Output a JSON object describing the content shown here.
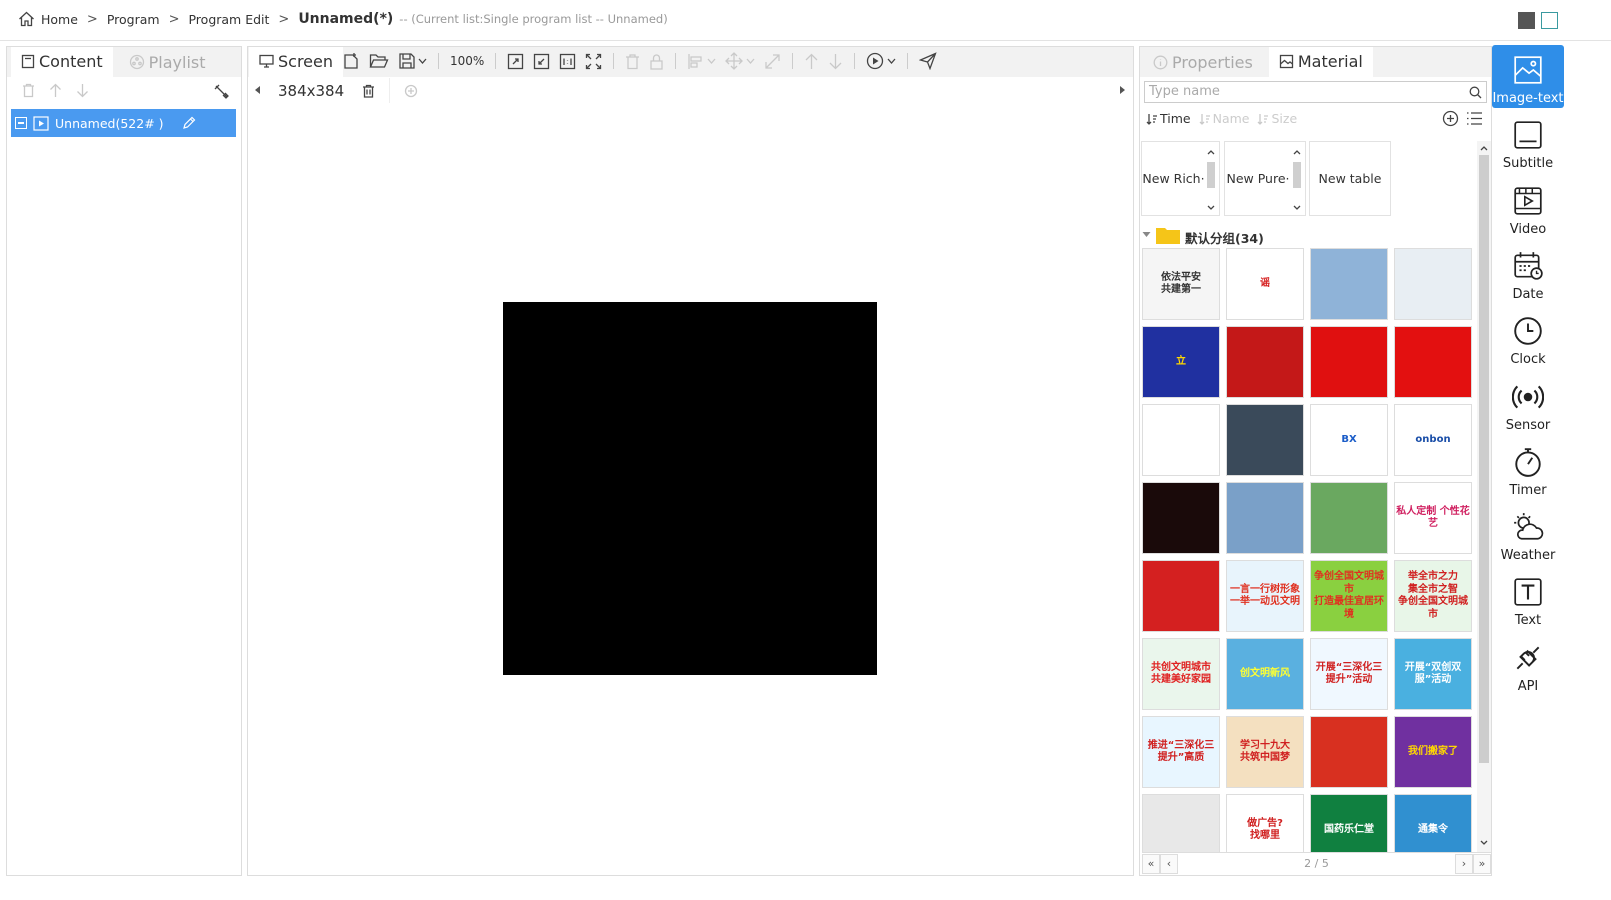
{
  "breadcrumb": {
    "home": "Home",
    "program": "Program",
    "program_edit": "Program Edit",
    "current": "Unnamed(*)",
    "info": "-- (Current list:Single program list -- Unnamed)"
  },
  "left_panel": {
    "tab_content": "Content",
    "tab_playlist": "Playlist",
    "tree_item": "Unnamed(522# )"
  },
  "center": {
    "tab_screen": "Screen",
    "zoom": "100%",
    "screen_size": "384x384"
  },
  "right_panel": {
    "tab_properties": "Properties",
    "tab_material": "Material",
    "search_placeholder": "Type name",
    "sort_time": "Time",
    "sort_name": "Name",
    "sort_size": "Size",
    "cards": [
      "New Rich·",
      "New Pure·",
      "New table"
    ],
    "group_label": "默认分组(34)",
    "pager": "2 / 5",
    "thumbnails": [
      {
        "text": "依法平安\n共建第一",
        "bg": "#f5f5f5",
        "fg": "#333"
      },
      {
        "text": "谣",
        "bg": "#ffffff",
        "fg": "#d62020"
      },
      {
        "text": "",
        "bg": "#8fb3d8",
        "fg": "#222"
      },
      {
        "text": "",
        "bg": "#e8eef3",
        "fg": "#555"
      },
      {
        "text": "立",
        "bg": "#2030a0",
        "fg": "#ffd700"
      },
      {
        "text": "",
        "bg": "#c41818",
        "fg": "#ffd700"
      },
      {
        "text": "",
        "bg": "#e01010",
        "fg": "#ffe000"
      },
      {
        "text": "",
        "bg": "#e31010",
        "fg": "#fff000"
      },
      {
        "text": "",
        "bg": "#ffffff",
        "fg": "#c00"
      },
      {
        "text": "",
        "bg": "#3a4a5a",
        "fg": "#fff"
      },
      {
        "text": "BX",
        "bg": "#ffffff",
        "fg": "#1a5cc8"
      },
      {
        "text": "onbon",
        "bg": "#ffffff",
        "fg": "#1a4ea8"
      },
      {
        "text": "",
        "bg": "#1a0a0a",
        "fg": "#e03030"
      },
      {
        "text": "",
        "bg": "#7aa0c8",
        "fg": "#222"
      },
      {
        "text": "",
        "bg": "#6aa860",
        "fg": "#fff"
      },
      {
        "text": "私人定制 个性花艺",
        "bg": "#ffffff",
        "fg": "#d02060"
      },
      {
        "text": "",
        "bg": "#d42020",
        "fg": "#ffd700"
      },
      {
        "text": "一言一行树形象\n一举一动见文明",
        "bg": "#e8f4fc",
        "fg": "#e03020"
      },
      {
        "text": "争创全国文明城市\n打造最佳宜居环境",
        "bg": "#8ad040",
        "fg": "#e03020"
      },
      {
        "text": "举全市之力\n集全市之智\n争创全国文明城市",
        "bg": "#e8f6e8",
        "fg": "#d02020"
      },
      {
        "text": "共创文明城市\n共建美好家园",
        "bg": "#eaf6ec",
        "fg": "#e02020"
      },
      {
        "text": "创文明新风",
        "bg": "#5ab0e0",
        "fg": "#ff3"
      },
      {
        "text": "开展“三深化三提升”活动",
        "bg": "#f0f8ff",
        "fg": "#d02020"
      },
      {
        "text": "开展“双创双服”活动",
        "bg": "#4ab0e0",
        "fg": "#fff"
      },
      {
        "text": "推进“三深化三提升”高质",
        "bg": "#e8f6ff",
        "fg": "#d02020"
      },
      {
        "text": "学习十九大\n共筑中国梦",
        "bg": "#f4e0c0",
        "fg": "#d02020"
      },
      {
        "text": "",
        "bg": "#d83020",
        "fg": "#ffd700"
      },
      {
        "text": "我们搬家了",
        "bg": "#7030a0",
        "fg": "#ffd700"
      },
      {
        "text": "",
        "bg": "#e8e8e8",
        "fg": "#c00"
      },
      {
        "text": "做广告?\n找哪里",
        "bg": "#ffffff",
        "fg": "#d02020"
      },
      {
        "text": "国药乐仁堂",
        "bg": "#108040",
        "fg": "#fff"
      },
      {
        "text": "通集令",
        "bg": "#3090d0",
        "fg": "#fff"
      }
    ]
  },
  "right_bar": [
    {
      "label": "Image-text",
      "icon": "image-text-icon"
    },
    {
      "label": "Subtitle",
      "icon": "subtitle-icon"
    },
    {
      "label": "Video",
      "icon": "video-icon"
    },
    {
      "label": "Date",
      "icon": "date-icon"
    },
    {
      "label": "Clock",
      "icon": "clock-icon"
    },
    {
      "label": "Sensor",
      "icon": "sensor-icon"
    },
    {
      "label": "Timer",
      "icon": "timer-icon"
    },
    {
      "label": "Weather",
      "icon": "weather-icon"
    },
    {
      "label": "Text",
      "icon": "text-icon"
    },
    {
      "label": "API",
      "icon": "api-icon"
    }
  ],
  "colors": {
    "accent": "#2f8ee8",
    "tree_selected": "#4a9af0",
    "folder": "#f5c518"
  }
}
